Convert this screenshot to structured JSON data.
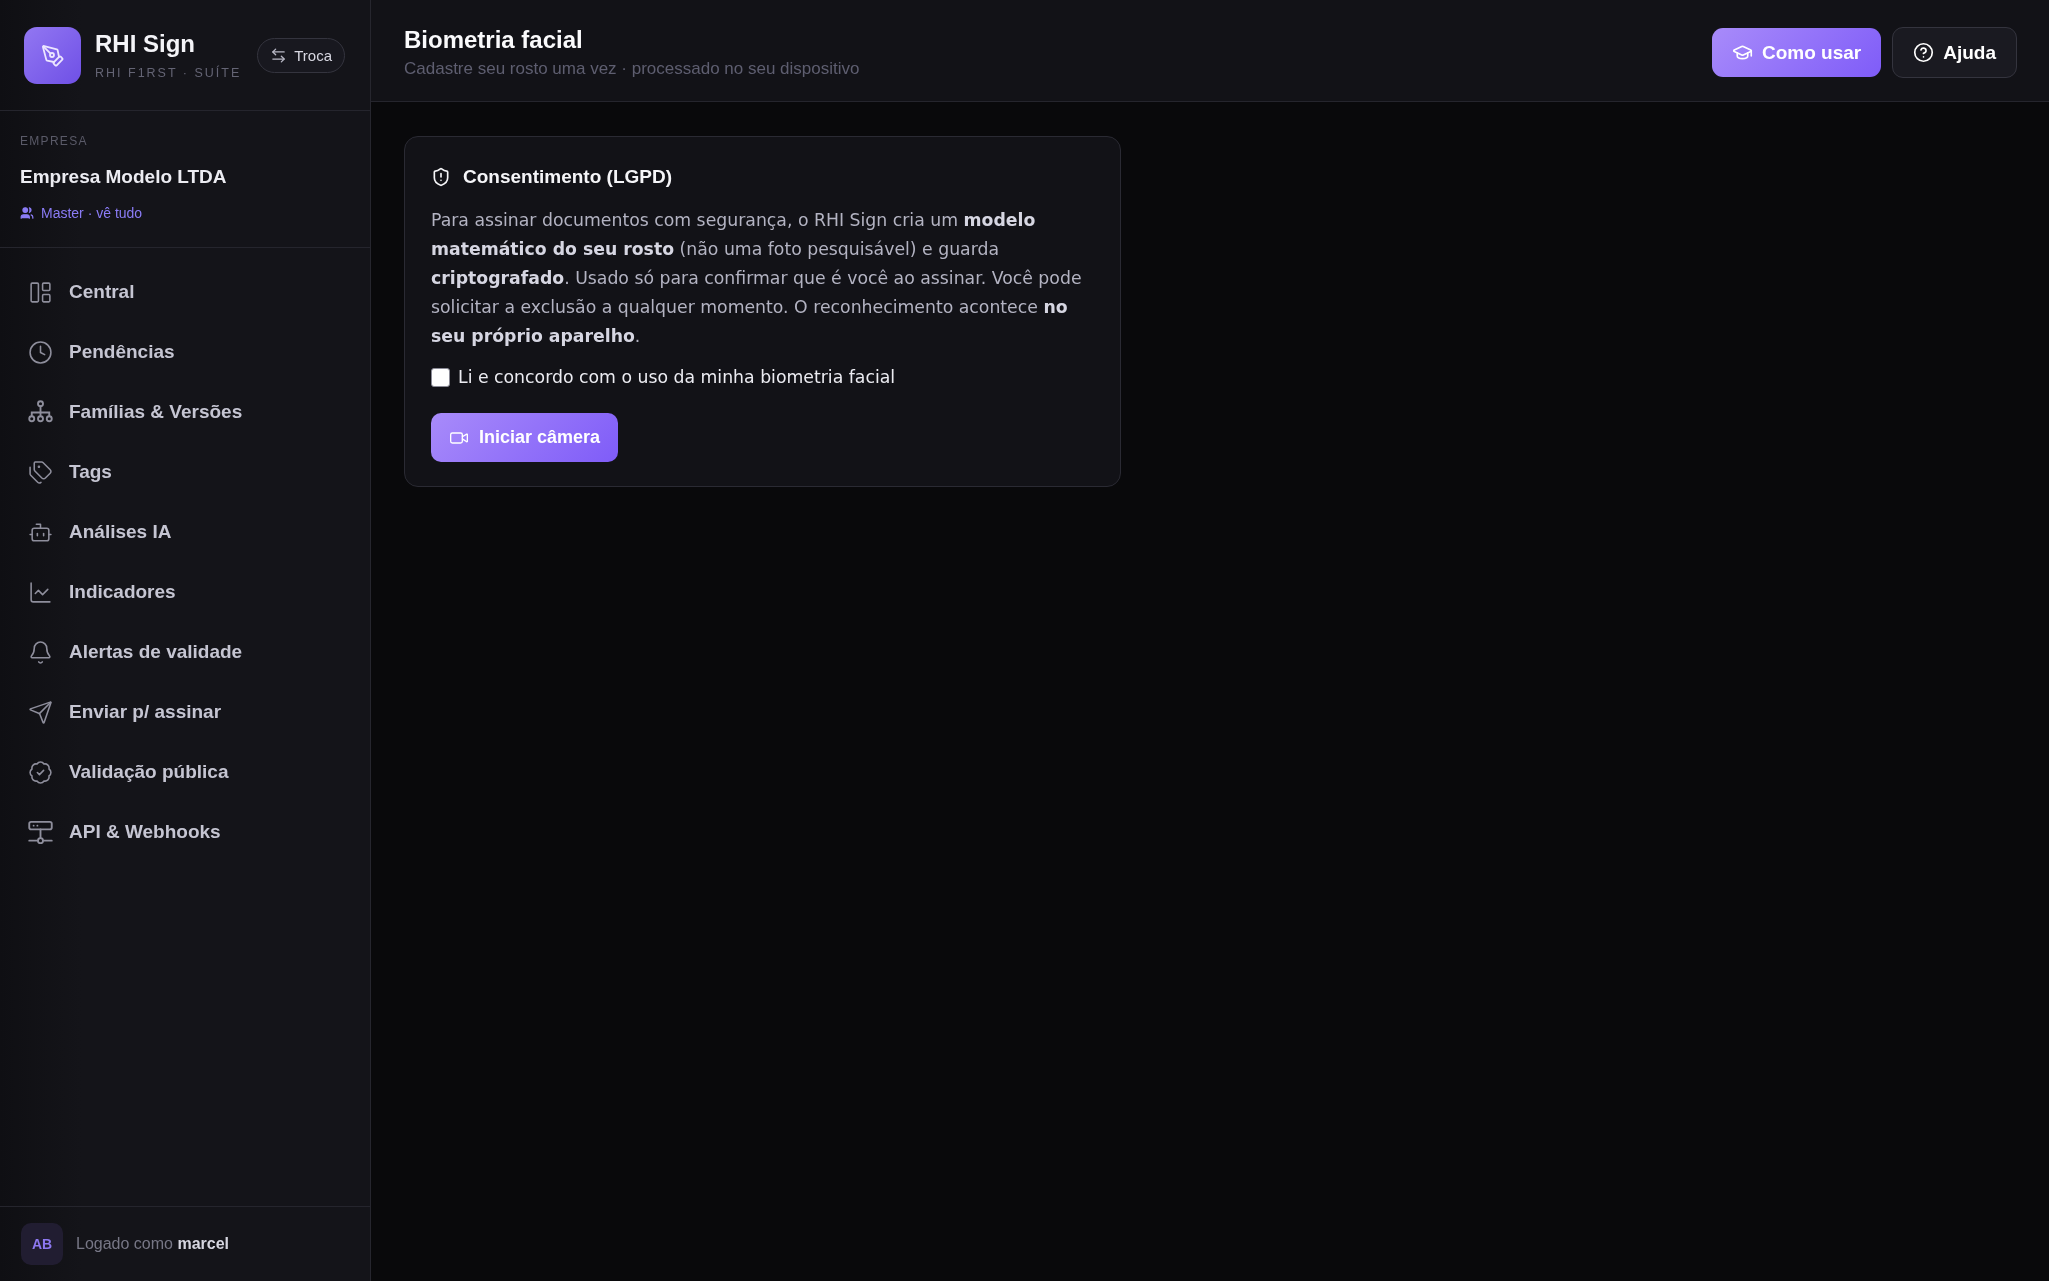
{
  "sidebar": {
    "brand": {
      "name": "RHI Sign",
      "tagline": "RHI F1RST · SUÍTE",
      "switch_button": "Troca"
    },
    "company": {
      "label": "EMPRESA",
      "name": "Empresa Modelo LTDA",
      "role": "Master · vê tudo"
    },
    "nav": [
      {
        "label": "Central",
        "selected": false
      },
      {
        "label": "Pendências",
        "selected": false
      },
      {
        "label": "Famílias & Versões",
        "selected": false
      },
      {
        "label": "Tags",
        "selected": false
      },
      {
        "label": "Análises IA",
        "selected": false
      },
      {
        "label": "Indicadores",
        "selected": false
      },
      {
        "label": "Alertas de validade",
        "selected": false
      },
      {
        "label": "Enviar p/ assinar",
        "selected": false
      },
      {
        "label": "Validação pública",
        "selected": false
      },
      {
        "label": "API & Webhooks",
        "selected": false
      }
    ],
    "footer": {
      "avatar": "AB",
      "text": "Logado como **marcel**"
    }
  },
  "header": {
    "title": "Biometria facial",
    "subtitle": "Cadastre seu rosto uma vez · processado no seu dispositivo",
    "buttons": [
      {
        "label": "Como usar",
        "kind": "primary"
      },
      {
        "label": "Ajuda",
        "kind": "secondary"
      }
    ]
  },
  "consent_card": {
    "title": "Consentimento (LGPD)",
    "text": "Para assinar documentos com segurança, o RHI Sign cria um **modelo matemático do seu rosto** (não uma foto pesquisável) e guarda **criptografado**. Usado só para confirmar que é você ao assinar. Você pode solicitar a exclusão a qualquer momento. O reconhecimento acontece **no seu próprio aparelho**.",
    "checkbox": {
      "label": "Li e concordo com o uso da minha biometria facial",
      "checked": false
    },
    "button": "Iniciar câmera"
  }
}
